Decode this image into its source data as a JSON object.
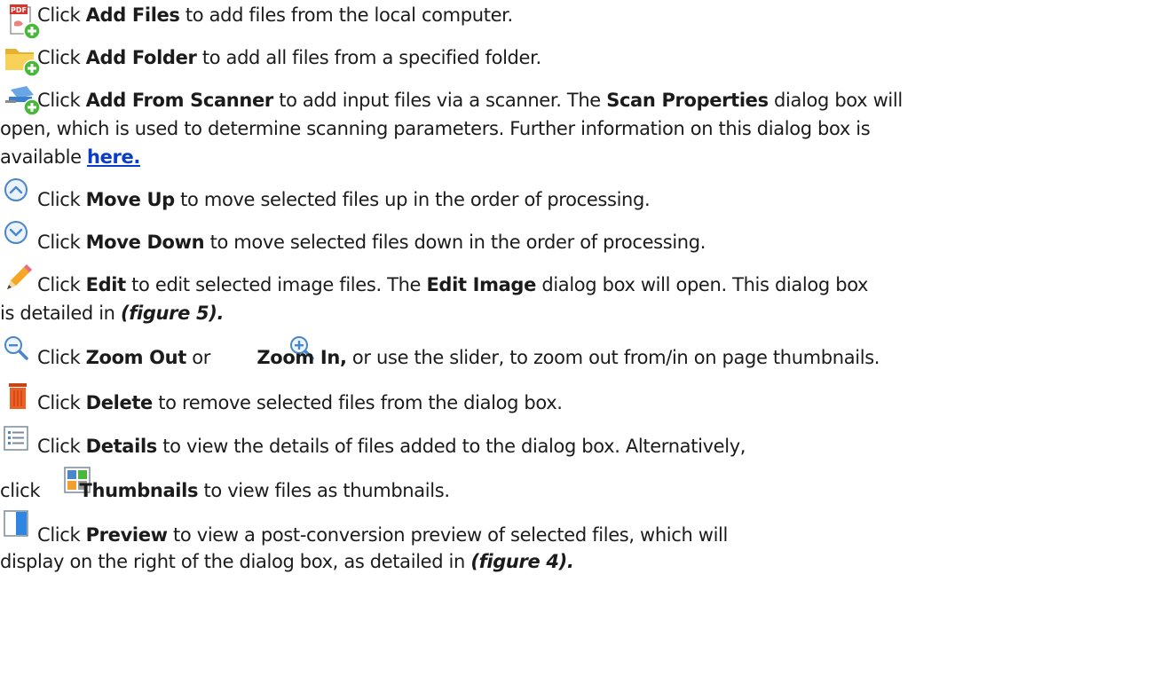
{
  "items": [
    {
      "id": "add_files",
      "icon": "add-files-icon",
      "parts": [
        "Click ",
        "Add Files",
        " to add files from the local computer."
      ]
    },
    {
      "id": "add_folder",
      "icon": "add-folder-icon",
      "parts": [
        "Click ",
        "Add Folder",
        " to add all files from a specified folder."
      ]
    },
    {
      "id": "add_scanner",
      "icon": "add-from-scanner-icon",
      "line1": [
        "Click ",
        "Add From Scanner",
        " to add input files via a scanner. The ",
        "Scan Properties",
        " dialog box will"
      ],
      "line2": "open, which is used to determine scanning parameters. Further information on this dialog box is",
      "line3": "available ",
      "link_text": "here."
    },
    {
      "id": "move_up",
      "icon": "move-up-icon",
      "parts": [
        "Click ",
        "Move Up",
        " to move selected files up in the order of processing."
      ]
    },
    {
      "id": "move_down",
      "icon": "move-down-icon",
      "parts": [
        "Click ",
        "Move Down",
        " to move selected files down in the order of processing."
      ]
    },
    {
      "id": "edit",
      "icon": "edit-pencil-icon",
      "line1": [
        "Click ",
        "Edit",
        " to edit selected image files. The ",
        "Edit Image",
        " dialog box will open. This dialog box"
      ],
      "line2": [
        "is detailed in ",
        "(figure 5)."
      ]
    },
    {
      "id": "zoom",
      "icon": "zoom-out-icon",
      "icon2": "zoom-in-icon",
      "parts": [
        "Click ",
        "Zoom Out",
        " or ",
        "Zoom In,",
        " or use the slider, to zoom out from/in on page thumbnails."
      ]
    },
    {
      "id": "delete",
      "icon": "delete-trash-icon",
      "parts": [
        "Click ",
        "Delete",
        " to remove selected files from the dialog box."
      ]
    },
    {
      "id": "details",
      "icon": "details-list-icon",
      "parts": [
        "Click ",
        "Details",
        " to view the details of files added to the dialog box. Alternatively,"
      ],
      "line2": [
        "click ",
        "Thumbnails",
        " to view files as thumbnails."
      ],
      "icon2": "thumbnails-icon"
    },
    {
      "id": "preview",
      "icon": "preview-pane-icon",
      "parts": [
        "Click ",
        "Preview",
        " to view a post-conversion preview of selected files, which will"
      ],
      "line2": [
        "display on the right of the dialog box, as detailed in ",
        "(figure 4)."
      ]
    }
  ],
  "icon_pdf_badge_text": "PDF",
  "colors": {
    "text": "#1b1b1b",
    "link": "#0a3ccc",
    "green_plus": "#48b83a",
    "folder": "#f2c53d",
    "trash": "#e8581f",
    "circle_blue": "#4a86c8"
  }
}
